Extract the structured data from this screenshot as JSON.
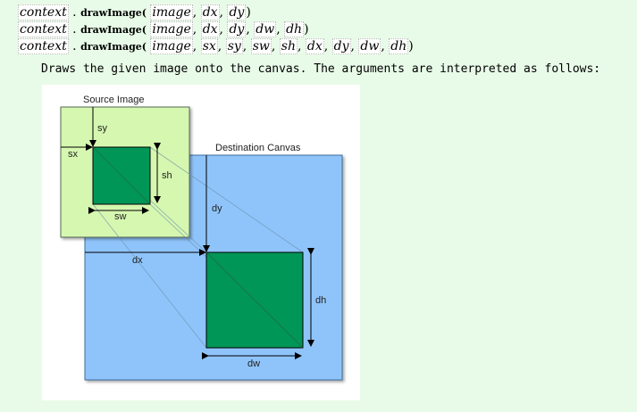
{
  "signatures": [
    {
      "context": "context",
      "dot": ".",
      "method": "drawImage(",
      "args": [
        "image",
        "dx",
        "dy"
      ],
      "close": ")"
    },
    {
      "context": "context",
      "dot": ".",
      "method": "drawImage(",
      "args": [
        "image",
        "dx",
        "dy",
        "dw",
        "dh"
      ],
      "close": ")"
    },
    {
      "context": "context",
      "dot": ".",
      "method": "drawImage(",
      "args": [
        "image",
        "sx",
        "sy",
        "sw",
        "sh",
        "dx",
        "dy",
        "dw",
        "dh"
      ],
      "close": ")"
    }
  ],
  "description": "Draws the given image onto the canvas. The arguments are interpreted as follows:",
  "diagram": {
    "source_label": "Source Image",
    "dest_label": "Destination Canvas",
    "sx": "sx",
    "sy": "sy",
    "sw": "sw",
    "sh": "sh",
    "dx": "dx",
    "dy": "dy",
    "dw": "dw",
    "dh": "dh",
    "colors": {
      "source_bg": "#d6f7b0",
      "dest_bg": "#8fc4fb",
      "square": "#009657"
    }
  }
}
